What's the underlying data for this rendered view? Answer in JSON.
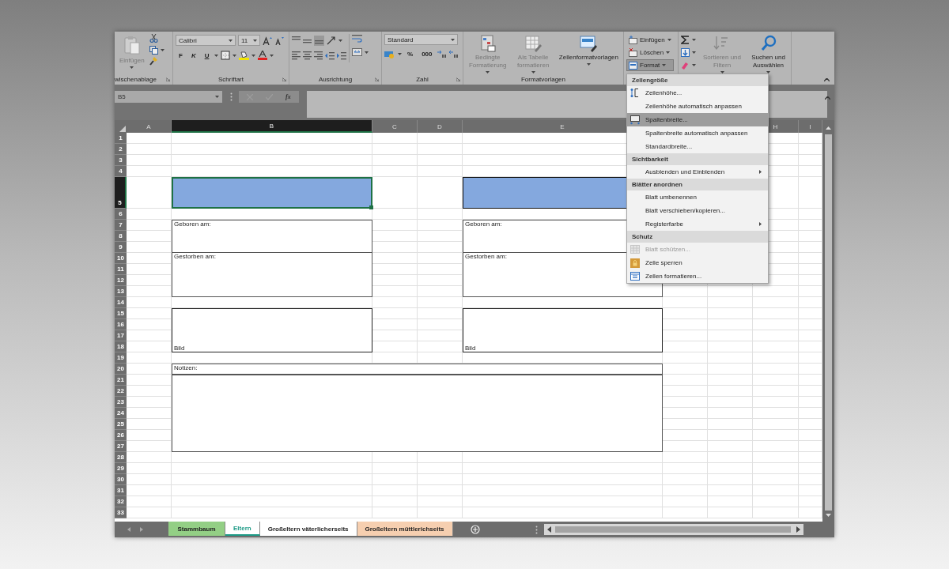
{
  "ribbon": {
    "groups": [
      {
        "kind": "clipboard",
        "label": "wischenablage",
        "launcher": true,
        "paste": {
          "label": "Einfügen",
          "disabled": true
        }
      },
      {
        "kind": "font",
        "label": "Schriftart",
        "launcher": true,
        "font": "Calibri",
        "size": "11",
        "styles": [
          "F",
          "K",
          "U"
        ]
      },
      {
        "kind": "alignment",
        "label": "Ausrichtung",
        "launcher": true
      },
      {
        "kind": "number",
        "label": "Zahl",
        "launcher": true,
        "format": "Standard",
        "buttons": [
          "%",
          "000"
        ]
      },
      {
        "kind": "styles",
        "label": "Formatvorlagen",
        "buttons": [
          {
            "label": "Bedingte Formatierung",
            "disabled": true
          },
          {
            "label": "Als Tabelle formatieren",
            "disabled": true
          },
          {
            "label": "Zellenformatvorlagen",
            "disabled": false
          }
        ]
      },
      {
        "kind": "cells",
        "buttons": [
          {
            "label": "Einfügen",
            "selected": false
          },
          {
            "label": "Löschen",
            "selected": false
          },
          {
            "label": "Format",
            "selected": true
          }
        ]
      },
      {
        "kind": "editing",
        "buttons": [
          {
            "label": "Sortieren und Filtern",
            "disabled": true
          },
          {
            "label": "Suchen und Auswählen",
            "disabled": false
          }
        ]
      }
    ]
  },
  "formula_bar": {
    "name_box": "B5",
    "function_button": "fx"
  },
  "sheet": {
    "columns": [
      {
        "label": "A",
        "selected": false
      },
      {
        "label": "B",
        "selected": true
      },
      {
        "label": "C",
        "selected": false
      },
      {
        "label": "D",
        "selected": false
      },
      {
        "label": "E",
        "selected": false
      },
      {},
      {},
      {
        "label": "H",
        "selected": false
      },
      {
        "label": "I",
        "selected": false
      }
    ],
    "rows": [
      {
        "label": "1",
        "selected": false
      },
      {
        "label": "2",
        "selected": false
      },
      {
        "label": "3",
        "selected": false
      },
      {
        "label": "4",
        "selected": false
      },
      {
        "label": "5",
        "selected": true
      },
      {
        "label": "6",
        "selected": false
      },
      {
        "label": "7",
        "selected": false
      },
      {
        "label": "8",
        "selected": false
      },
      {
        "label": "9",
        "selected": false
      },
      {
        "label": "10",
        "selected": false
      },
      {
        "label": "11",
        "selected": false
      },
      {
        "label": "12",
        "selected": false
      },
      {
        "label": "13",
        "selected": false
      },
      {
        "label": "14",
        "selected": false
      },
      {
        "label": "15",
        "selected": false
      },
      {
        "label": "16",
        "selected": false
      },
      {
        "label": "17",
        "selected": false
      },
      {
        "label": "18",
        "selected": false
      },
      {
        "label": "19",
        "selected": false
      },
      {
        "label": "20",
        "selected": false
      },
      {
        "label": "21",
        "selected": false
      },
      {
        "label": "22",
        "selected": false
      },
      {
        "label": "23",
        "selected": false
      },
      {
        "label": "24",
        "selected": false
      },
      {
        "label": "25",
        "selected": false
      },
      {
        "label": "26",
        "selected": false
      },
      {
        "label": "27",
        "selected": false
      },
      {
        "label": "28",
        "selected": false
      },
      {
        "label": "29",
        "selected": false
      },
      {
        "label": "30",
        "selected": false
      },
      {
        "label": "31",
        "selected": false
      },
      {
        "label": "32",
        "selected": false
      },
      {
        "label": "33",
        "selected": false
      }
    ],
    "blocks": [
      {
        "kind": "name-field",
        "selected": true
      },
      {
        "kind": "name-field",
        "selected": false
      },
      {
        "kind": "label-box",
        "text": "Geboren am:"
      },
      {
        "kind": "label-box",
        "text": "Geboren am:"
      },
      {
        "kind": "label-box",
        "text": "Gestorben am:"
      },
      {
        "kind": "label-box",
        "text": "Gestorben am:"
      },
      {
        "kind": "picture-box",
        "text": "Bild"
      },
      {
        "kind": "picture-box",
        "text": "Bild"
      },
      {
        "kind": "label-box",
        "text": "Notizen:"
      },
      {
        "kind": "frame"
      }
    ]
  },
  "menu": {
    "sections": [
      {
        "title": "Zellengröße",
        "items": [
          {
            "label": "Zeilenhöhe...",
            "selected": false,
            "disabled": false,
            "submenu": false
          },
          {
            "label": "Zeilenhöhe automatisch anpassen",
            "selected": false,
            "disabled": false,
            "submenu": false
          },
          {
            "label": "Spaltenbreite...",
            "selected": true,
            "disabled": false,
            "submenu": false
          },
          {
            "label": "Spaltenbreite automatisch anpassen",
            "selected": false,
            "disabled": false,
            "submenu": false
          },
          {
            "label": "Standardbreite...",
            "selected": false,
            "disabled": false,
            "submenu": false
          }
        ]
      },
      {
        "title": "Sichtbarkeit",
        "items": [
          {
            "label": "Ausblenden und Einblenden",
            "selected": false,
            "disabled": false,
            "submenu": true
          }
        ]
      },
      {
        "title": "Blätter anordnen",
        "items": [
          {
            "label": "Blatt umbenennen",
            "selected": false,
            "disabled": false,
            "submenu": false
          },
          {
            "label": "Blatt verschieben/kopieren...",
            "selected": false,
            "disabled": false,
            "submenu": false
          },
          {
            "label": "Registerfarbe",
            "selected": false,
            "disabled": false,
            "submenu": true
          }
        ]
      },
      {
        "title": "Schutz",
        "items": [
          {
            "label": "Blatt schützen...",
            "selected": false,
            "disabled": true,
            "submenu": false
          },
          {
            "label": "Zelle sperren",
            "selected": false,
            "disabled": false,
            "submenu": false
          },
          {
            "label": "Zellen formatieren...",
            "selected": false,
            "disabled": false,
            "submenu": false
          }
        ]
      }
    ]
  },
  "sheet_tabs": [
    {
      "label": "Stammbaum",
      "selected": false,
      "color": "#93cf85"
    },
    {
      "label": "Eltern",
      "selected": true,
      "color": "#1c9a86"
    },
    {
      "label": "Großeltern väterlicherseits",
      "selected": false,
      "color": "#ffffff"
    },
    {
      "label": "Großeltern müttlerichseits",
      "selected": false,
      "color": "#f6cfb0"
    }
  ]
}
